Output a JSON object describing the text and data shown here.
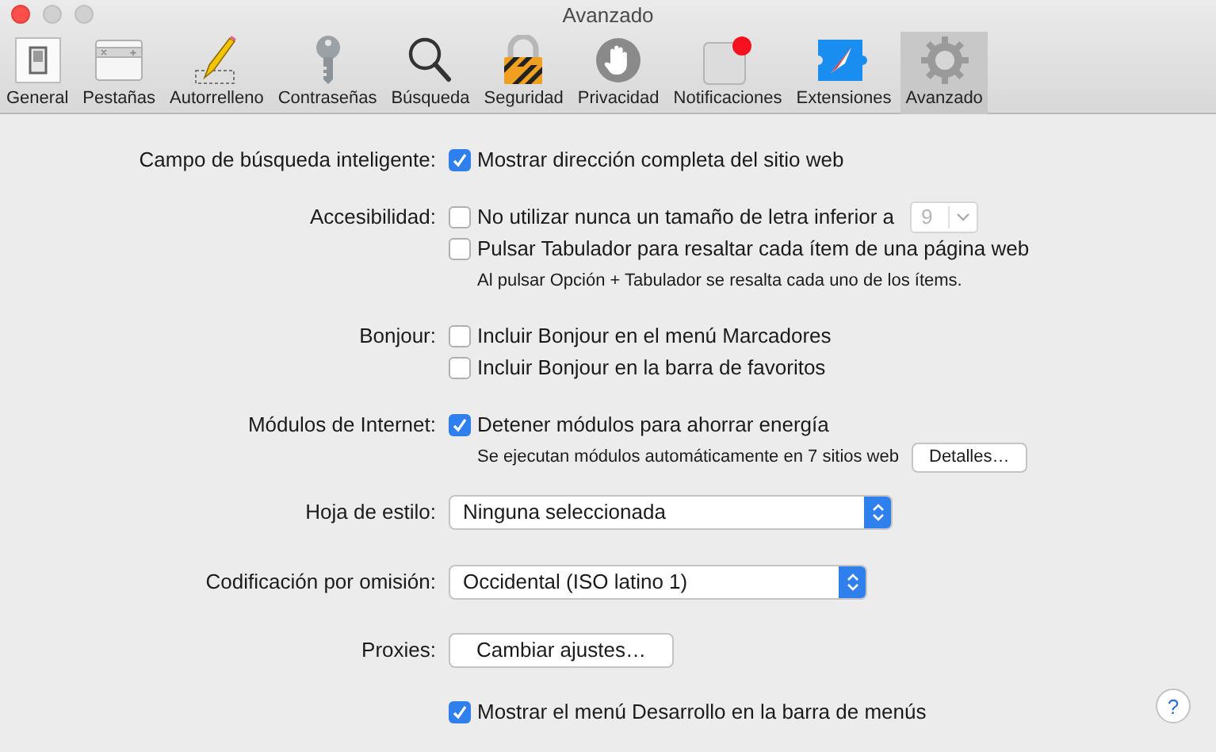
{
  "window": {
    "title": "Avanzado"
  },
  "toolbar": [
    {
      "label": "General",
      "kind": "switch",
      "selected": false
    },
    {
      "label": "Pestañas",
      "kind": "tabs",
      "selected": false
    },
    {
      "label": "Autorrelleno",
      "kind": "pencil",
      "selected": false
    },
    {
      "label": "Contraseñas",
      "kind": "key",
      "selected": false
    },
    {
      "label": "Búsqueda",
      "kind": "magnifier",
      "selected": false
    },
    {
      "label": "Seguridad",
      "kind": "lock",
      "selected": false
    },
    {
      "label": "Privacidad",
      "kind": "hand",
      "selected": false
    },
    {
      "label": "Notificaciones",
      "kind": "notification",
      "selected": false
    },
    {
      "label": "Extensiones",
      "kind": "puzzle",
      "selected": false
    },
    {
      "label": "Avanzado",
      "kind": "gear",
      "selected": true
    }
  ],
  "sections": [
    {
      "label": "Campo de búsqueda inteligente:",
      "items": [
        {
          "kind": "checkbox",
          "label": "Mostrar dirección completa del sitio web",
          "checked": true
        }
      ]
    },
    {
      "label": "Accesibilidad:",
      "items": [
        {
          "kind": "checkbox",
          "label": "No utilizar nunca un tamaño de letra inferior a",
          "checked": false,
          "popup": {
            "value": "9",
            "disabled": true
          }
        },
        {
          "kind": "checkbox",
          "label": "Pulsar Tabulador para resaltar cada ítem de una página web",
          "checked": false
        },
        {
          "kind": "note",
          "text": "Al pulsar Opción + Tabulador se resalta cada uno de los ítems."
        }
      ]
    },
    {
      "label": "Bonjour:",
      "items": [
        {
          "kind": "checkbox",
          "label": "Incluir Bonjour en el menú Marcadores",
          "checked": false
        },
        {
          "kind": "checkbox",
          "label": "Incluir Bonjour en la barra de favoritos",
          "checked": false
        }
      ]
    },
    {
      "label": "Módulos de Internet:",
      "items": [
        {
          "kind": "checkbox",
          "label": "Detener módulos para ahorrar energía",
          "checked": true
        },
        {
          "kind": "note",
          "text": "Se ejecutan módulos automáticamente en 7 sitios web",
          "button": "Detalles…"
        }
      ]
    },
    {
      "label": "Hoja de estilo:",
      "items": [
        {
          "kind": "popup",
          "value": "Ninguna seleccionada"
        }
      ]
    },
    {
      "label": "Codificación por omisión:",
      "items": [
        {
          "kind": "popup",
          "value": "Occidental (ISO latino 1)"
        }
      ]
    },
    {
      "label": "Proxies:",
      "items": [
        {
          "kind": "button",
          "label": "Cambiar ajustes…"
        }
      ]
    },
    {
      "items": [
        {
          "kind": "checkbox",
          "label": "Mostrar el menú Desarrollo en la barra de menús",
          "checked": true
        }
      ]
    }
  ],
  "help_button": "?"
}
